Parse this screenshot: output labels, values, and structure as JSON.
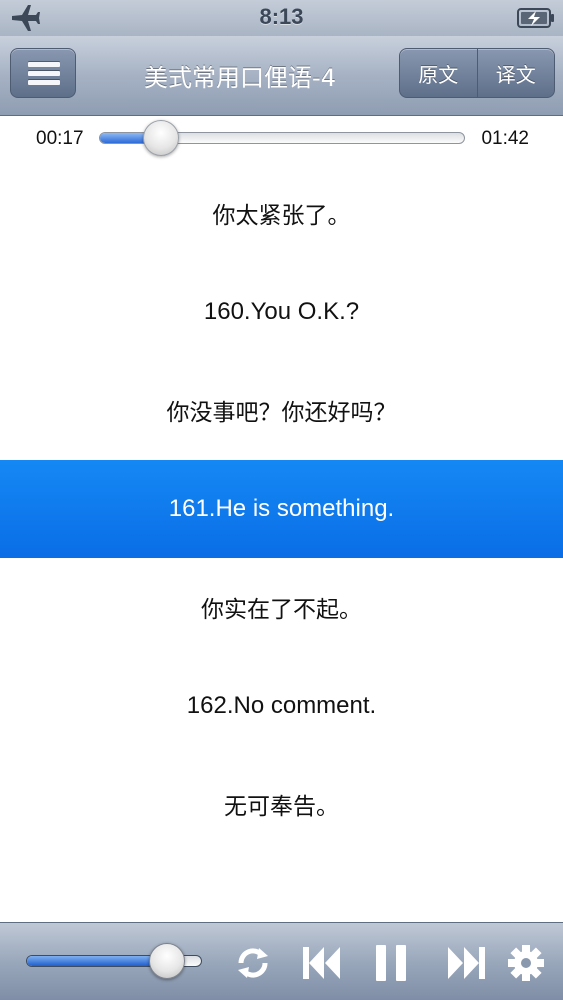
{
  "status_bar": {
    "time": "8:13",
    "icons": [
      "airplane-icon",
      "battery-charging-icon"
    ]
  },
  "nav": {
    "title": "美式常用口俚语-4",
    "menu_icon": "hamburger-icon",
    "segments": [
      "原文",
      "译文"
    ]
  },
  "player": {
    "elapsed": "00:17",
    "total": "01:42",
    "progress": 0.17,
    "volume": 0.8
  },
  "transcript": [
    {
      "text": "你太紧张了。",
      "lang": "zh",
      "active": false
    },
    {
      "text": "160.You O.K.?",
      "lang": "en",
      "active": false
    },
    {
      "text": "你没事吧？你还好吗？",
      "lang": "zh",
      "active": false
    },
    {
      "text": "161.He is something.",
      "lang": "en",
      "active": true
    },
    {
      "text": "你实在了不起。",
      "lang": "zh",
      "active": false
    },
    {
      "text": "162.No comment.",
      "lang": "en",
      "active": false
    },
    {
      "text": "无可奉告。",
      "lang": "zh",
      "active": false
    }
  ],
  "toolbar": {
    "icons": [
      "repeat-icon",
      "previous-track-icon",
      "pause-icon",
      "next-track-icon",
      "settings-gear-icon"
    ]
  },
  "colors": {
    "highlight": "#0a6ee6",
    "bar_top": "#c8d0dc",
    "bar_bottom": "#8f9db2",
    "progress_fill": "#2c6bd8"
  }
}
